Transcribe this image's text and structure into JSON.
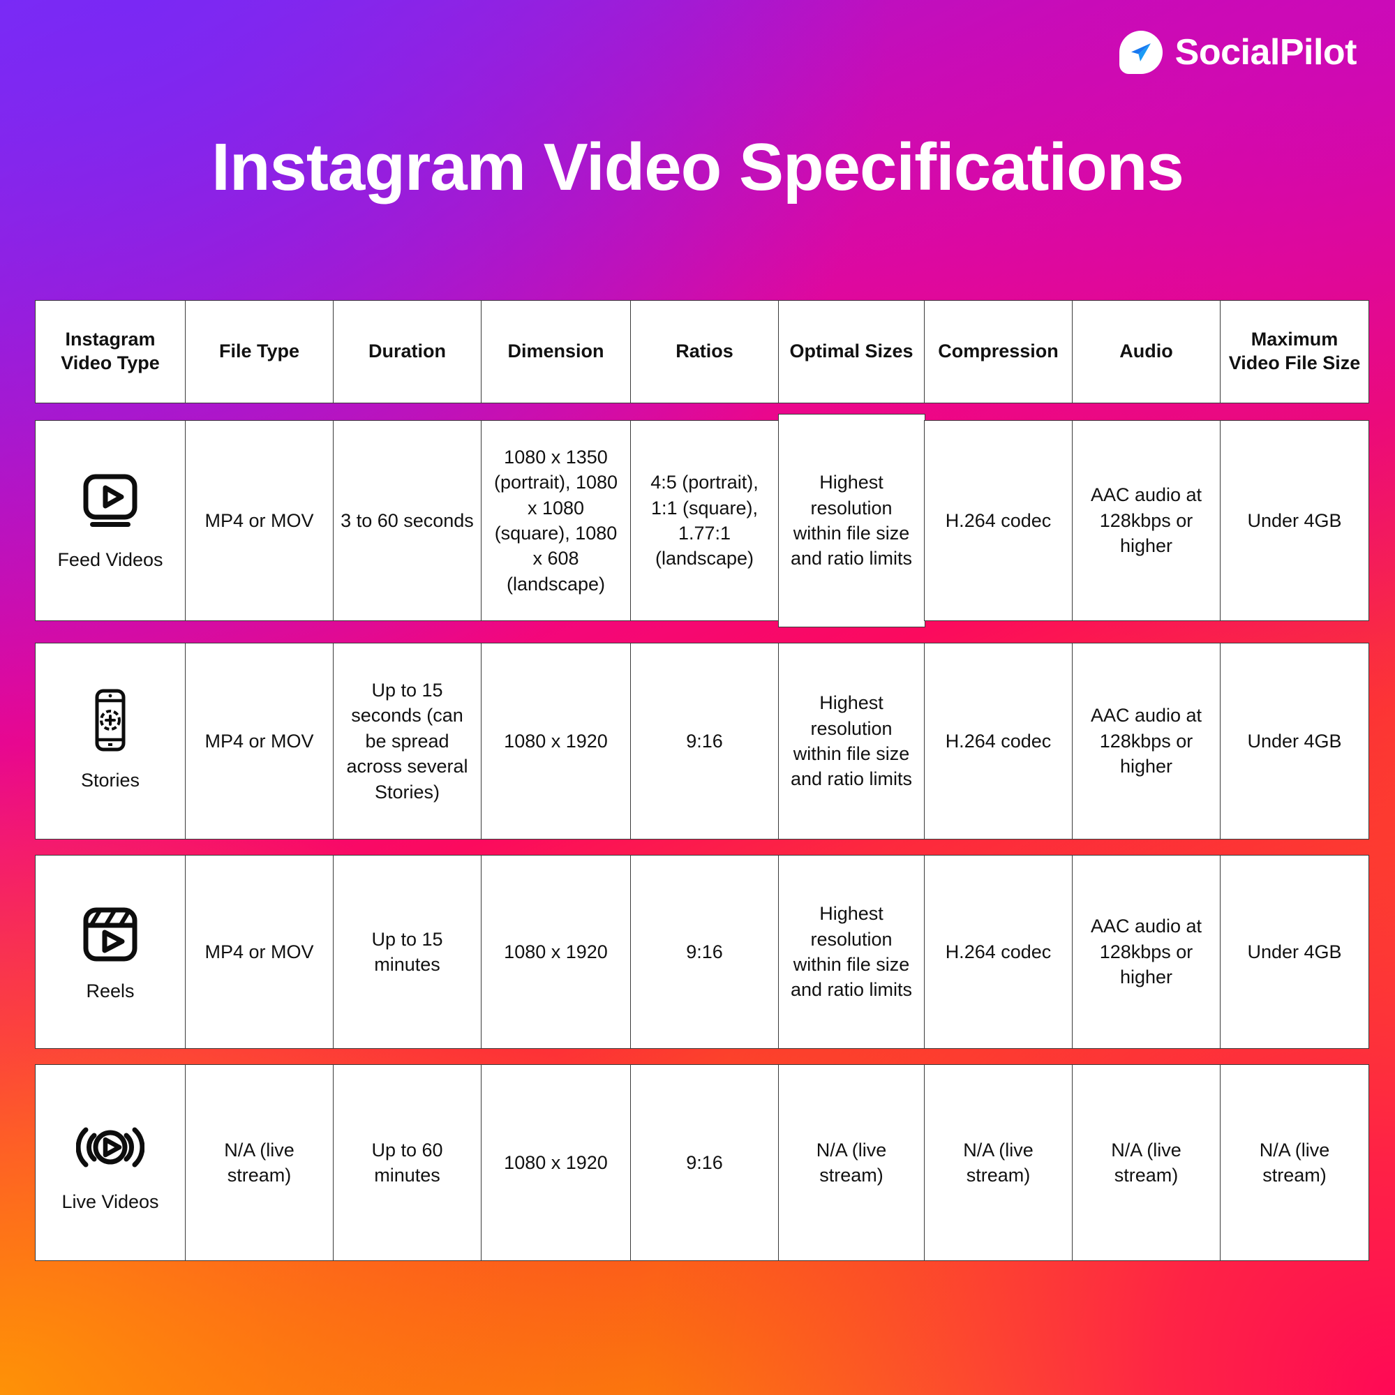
{
  "brand": {
    "name": "SocialPilot",
    "logo_icon": "paper-plane-icon",
    "accent_blue": "#1878f0",
    "logo_bg": "#ffffff"
  },
  "title": "Instagram Video Specifications",
  "theme": {
    "gradient_top_left": "#7b2ff7",
    "gradient_mid": "#e0089c",
    "gradient_bottom_left": "#fca004",
    "gradient_bottom_right": "#ff0a55",
    "cell_bg": "#ffffff",
    "cell_border": "#3a3a3a",
    "text": "#111111"
  },
  "table": {
    "headers": [
      "Instagram Video Type",
      "File Type",
      "Duration",
      "Dimension",
      "Ratios",
      "Optimal Sizes",
      "Compression",
      "Audio",
      "Maximum Video File Size"
    ],
    "rows": [
      {
        "type_label": "Feed Videos",
        "type_icon": "video-monitor-play-icon",
        "file_type": "MP4 or MOV",
        "duration": "3 to 60 seconds",
        "dimension": "1080 x 1350 (portrait), 1080 x 1080 (square), 1080 x 608 (landscape)",
        "ratios": "4:5 (portrait), 1:1 (square), 1.77:1 (landscape)",
        "optimal_sizes": "Highest resolution within file size and ratio limits",
        "compression": "H.264 codec",
        "audio": "AAC audio at 128kbps or higher",
        "max_file_size": "Under 4GB"
      },
      {
        "type_label": "Stories",
        "type_icon": "phone-add-story-icon",
        "file_type": "MP4 or MOV",
        "duration": "Up to 15 seconds (can be spread across several Stories)",
        "dimension": "1080 x 1920",
        "ratios": "9:16",
        "optimal_sizes": "Highest resolution within file size and ratio limits",
        "compression": "H.264 codec",
        "audio": "AAC audio at 128kbps or higher",
        "max_file_size": "Under 4GB"
      },
      {
        "type_label": "Reels",
        "type_icon": "clapperboard-play-icon",
        "file_type": "MP4 or MOV",
        "duration": "Up to 15 minutes",
        "dimension": "1080 x 1920",
        "ratios": "9:16",
        "optimal_sizes": "Highest resolution within file size and ratio limits",
        "compression": "H.264 codec",
        "audio": "AAC audio at 128kbps or higher",
        "max_file_size": "Under 4GB"
      },
      {
        "type_label": "Live Videos",
        "type_icon": "broadcast-play-icon",
        "file_type": "N/A (live stream)",
        "duration": "Up to 60 minutes",
        "dimension": "1080 x 1920",
        "ratios": "9:16",
        "optimal_sizes": "N/A (live stream)",
        "compression": "N/A (live stream)",
        "audio": "N/A (live stream)",
        "max_file_size": "N/A (live stream)"
      }
    ]
  }
}
